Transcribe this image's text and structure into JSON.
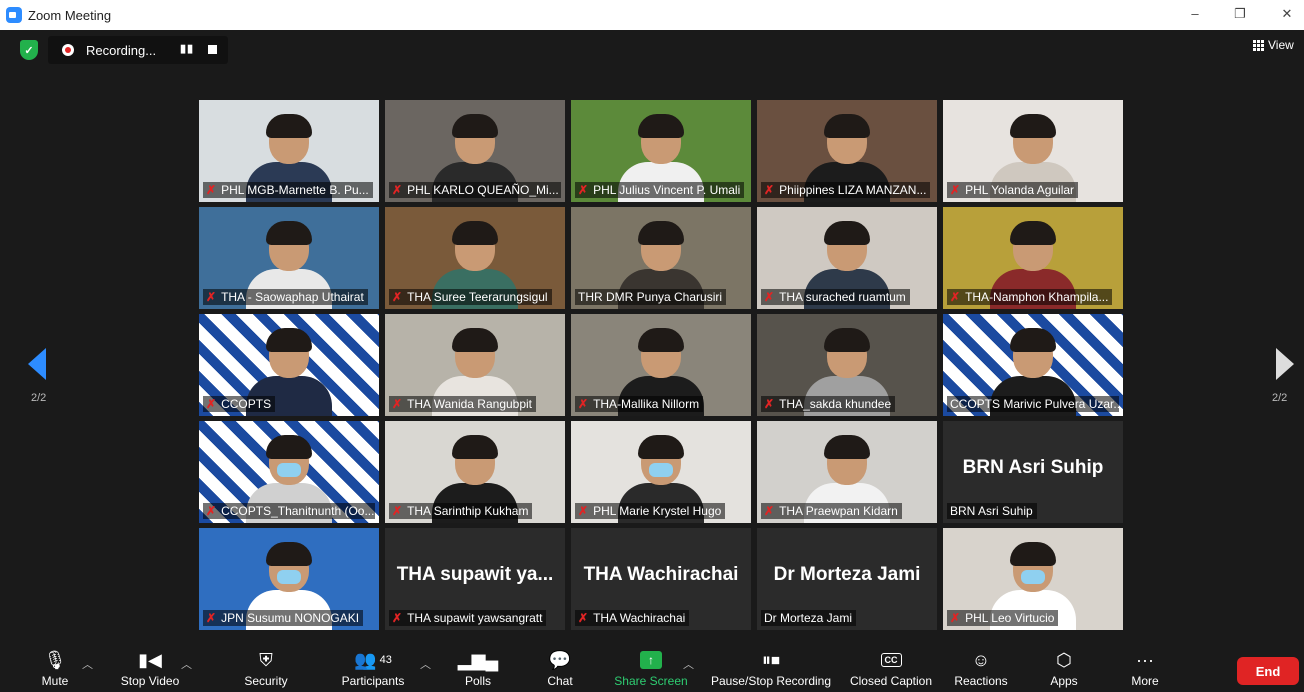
{
  "window": {
    "title": "Zoom Meeting",
    "minimize": "–",
    "restore": "❐",
    "close": "✕"
  },
  "recording": {
    "status": "Recording...",
    "pause_icon": "pause-icon",
    "stop_icon": "stop-icon",
    "dot_color": "#e02424"
  },
  "view_button": {
    "label": "View"
  },
  "pagination": {
    "left_label": "2/2",
    "right_label": "2/2",
    "accent": "#2d8cff"
  },
  "participants": [
    {
      "name": "PHL MGB-Marnette B. Pu...",
      "muted": true,
      "video": true,
      "bg": "#d8dde0",
      "torso": "#2b3a55",
      "mask": false
    },
    {
      "name": "PHL KARLO QUEAÑO_Mi...",
      "muted": true,
      "video": true,
      "bg": "#6b6661",
      "torso": "#2a2a2a",
      "mask": false
    },
    {
      "name": "PHL Julius Vincent P. Umali",
      "muted": true,
      "video": true,
      "bg": "#5c8a3a",
      "torso": "#f0f0f0",
      "mask": false
    },
    {
      "name": "Phiippines LIZA MANZAN...",
      "muted": true,
      "video": true,
      "bg": "#6a5040",
      "torso": "#1c1c1c",
      "mask": false
    },
    {
      "name": "PHL Yolanda Aguilar",
      "muted": true,
      "video": true,
      "bg": "#e7e3df",
      "torso": "#cfc8bf",
      "mask": false
    },
    {
      "name": "THA - Saowaphap Uthairat",
      "muted": true,
      "video": true,
      "bg": "#3f6f9a",
      "torso": "#e8e8e8",
      "mask": false
    },
    {
      "name": "THA Suree Teerarungsigul",
      "muted": true,
      "video": true,
      "bg": "#7a5a3a",
      "torso": "#3a6f62",
      "mask": false
    },
    {
      "name": "THR DMR Punya Charusiri",
      "muted": false,
      "video": true,
      "bg": "#7c7565",
      "torso": "#3a3530",
      "mask": false
    },
    {
      "name": "THA surached ruamtum",
      "muted": true,
      "video": true,
      "bg": "#cfc9c2",
      "torso": "#2e3a4a",
      "mask": false
    },
    {
      "name": "THA-Namphon Khampila...",
      "muted": true,
      "video": true,
      "bg": "#b8a03a",
      "torso": "#8a2a2a",
      "mask": false
    },
    {
      "name": "CCOPTS",
      "muted": true,
      "video": true,
      "bg": "logo",
      "torso": "#1f2a44",
      "mask": false
    },
    {
      "name": "THA Wanida Rangubpit",
      "muted": true,
      "video": true,
      "bg": "#b7b3a9",
      "torso": "#e8e4df",
      "mask": false
    },
    {
      "name": "THA-Mallika Nillorm",
      "muted": true,
      "video": true,
      "bg": "#8a857a",
      "torso": "#1c1c1c",
      "mask": false
    },
    {
      "name": "THA_sakda khundee",
      "muted": true,
      "video": true,
      "bg": "#57534c",
      "torso": "#a0a0a0",
      "mask": false
    },
    {
      "name": "CCOPTS Marivic Pulvera Uzar...",
      "muted": false,
      "video": true,
      "bg": "logo",
      "torso": "#1c1c1c",
      "mask": false,
      "active": true
    },
    {
      "name": "CCOPTS_Thanitnunth (Oo...",
      "muted": true,
      "video": true,
      "bg": "logo",
      "torso": "#d0d0d0",
      "mask": true
    },
    {
      "name": "THA Sarinthip Kukham",
      "muted": true,
      "video": true,
      "bg": "#d9d7d2",
      "torso": "#1c1c1c",
      "mask": false
    },
    {
      "name": "PHL Marie Krystel Hugo",
      "muted": true,
      "video": true,
      "bg": "#e4e2de",
      "torso": "#2a2a2a",
      "mask": true
    },
    {
      "name": "THA Praewpan Kidarn",
      "muted": true,
      "video": true,
      "bg": "#d2d0cc",
      "torso": "#f2f2f2",
      "mask": false
    },
    {
      "name": "BRN Asri Suhip",
      "muted": false,
      "video": false,
      "bg": "#2b2b2b"
    },
    {
      "name": "JPN Susumu NONOGAKI",
      "muted": true,
      "video": true,
      "bg": "#2f6ec0",
      "torso": "#ffffff",
      "mask": true
    },
    {
      "name": "THA supawit yawsangratt",
      "muted": true,
      "video": false,
      "bg": "#2b2b2b",
      "big": "THA supawit ya..."
    },
    {
      "name": "THA Wachirachai",
      "muted": true,
      "video": false,
      "bg": "#2b2b2b",
      "big": "THA Wachirachai"
    },
    {
      "name": "Dr Morteza Jami",
      "muted": false,
      "video": false,
      "bg": "#2b2b2b",
      "big": "Dr Morteza Jami"
    },
    {
      "name": "PHL Leo Virtucio",
      "muted": true,
      "video": true,
      "bg": "#d8d3cc",
      "torso": "#ffffff",
      "mask": true
    }
  ],
  "toolbar": {
    "mute": "Mute",
    "stop_video": "Stop Video",
    "security": "Security",
    "participants": "Participants",
    "participant_count": "43",
    "polls": "Polls",
    "chat": "Chat",
    "share_screen": "Share Screen",
    "pause_stop_recording": "Pause/Stop Recording",
    "closed_caption": "Closed Caption",
    "cc_icon_text": "CC",
    "reactions": "Reactions",
    "apps": "Apps",
    "more": "More",
    "end": "End",
    "share_color": "#22b14c",
    "end_color": "#e02424"
  }
}
